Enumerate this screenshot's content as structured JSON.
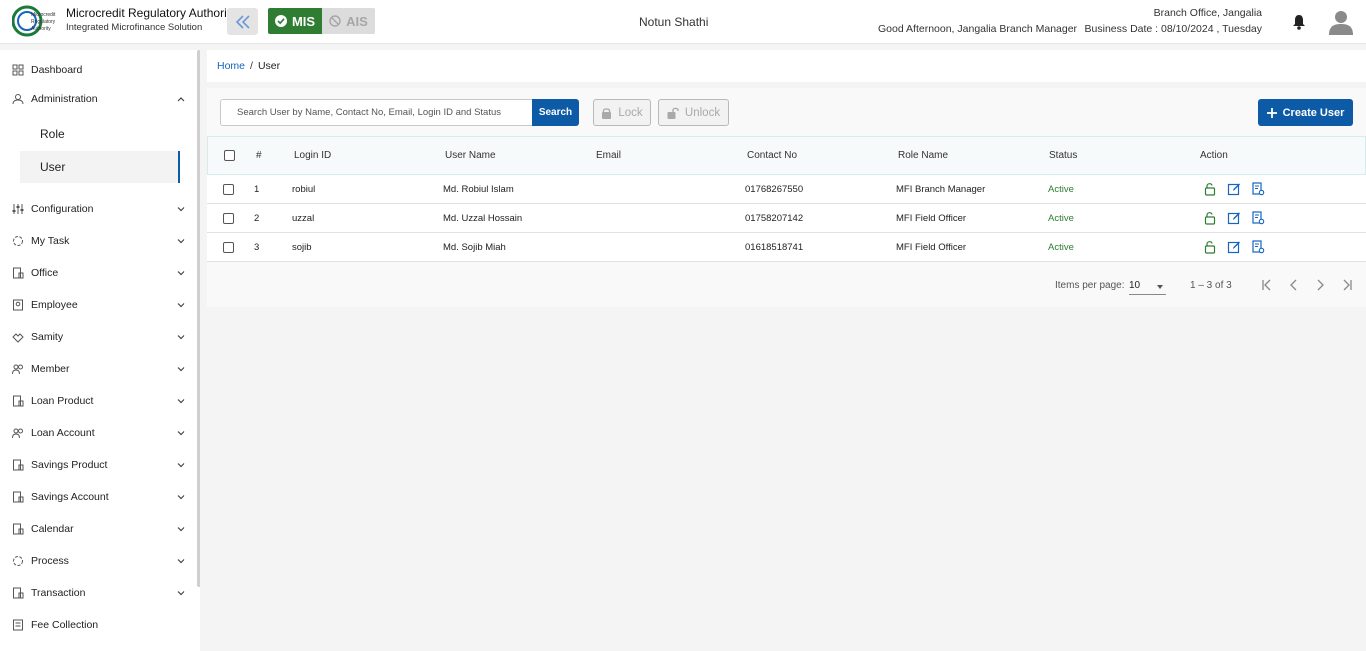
{
  "header": {
    "org_name": "Microcredit Regulatory Authority",
    "org_sub": "Integrated Microfinance Solution",
    "logo_text": [
      "Microcredit",
      "Regulatory",
      "Authority"
    ],
    "mis_label": "MIS",
    "ais_label": "AIS",
    "app_title": "Notun Shathi",
    "greeting": "Good Afternoon, Jangalia Branch Manager",
    "branch": "Branch Office, Jangalia",
    "business_date": "Business Date : 08/10/2024 , Tuesday"
  },
  "sidebar": {
    "items": [
      {
        "label": "Dashboard",
        "icon": "grid-icon"
      },
      {
        "label": "Administration",
        "icon": "admin-icon",
        "expanded": true
      },
      {
        "label": "Role"
      },
      {
        "label": "User",
        "active": true
      },
      {
        "label": "Configuration",
        "icon": "sliders-icon"
      },
      {
        "label": "My Task",
        "icon": "task-icon"
      },
      {
        "label": "Office",
        "icon": "office-icon"
      },
      {
        "label": "Employee",
        "icon": "employee-icon"
      },
      {
        "label": "Samity",
        "icon": "samity-icon"
      },
      {
        "label": "Member",
        "icon": "member-icon"
      },
      {
        "label": "Loan Product",
        "icon": "loan-product-icon"
      },
      {
        "label": "Loan Account",
        "icon": "loan-account-icon"
      },
      {
        "label": "Savings Product",
        "icon": "savings-product-icon"
      },
      {
        "label": "Savings Account",
        "icon": "savings-account-icon"
      },
      {
        "label": "Calendar",
        "icon": "calendar-icon"
      },
      {
        "label": "Process",
        "icon": "process-icon"
      },
      {
        "label": "Transaction",
        "icon": "transaction-icon"
      },
      {
        "label": "Fee Collection",
        "icon": "fee-icon"
      }
    ]
  },
  "breadcrumb": {
    "home": "Home",
    "sep": "/",
    "current": "User"
  },
  "toolbar": {
    "search_placeholder": "Search User by Name, Contact No, Email, Login ID and Status",
    "search_label": "Search",
    "lock_label": "Lock",
    "unlock_label": "Unlock",
    "create_label": "Create User"
  },
  "table": {
    "columns": [
      "#",
      "Login ID",
      "User Name",
      "Email",
      "Contact No",
      "Role Name",
      "Status",
      "Action"
    ],
    "rows": [
      {
        "num": "1",
        "login": "robiul",
        "name": "Md. Robiul Islam",
        "email": "",
        "contact": "01768267550",
        "role": "MFI Branch Manager",
        "status": "Active"
      },
      {
        "num": "2",
        "login": "uzzal",
        "name": "Md. Uzzal Hossain",
        "email": "",
        "contact": "01758207142",
        "role": "MFI Field Officer",
        "status": "Active"
      },
      {
        "num": "3",
        "login": "sojib",
        "name": "Md. Sojib Miah",
        "email": "",
        "contact": "01618518741",
        "role": "MFI Field Officer",
        "status": "Active"
      }
    ]
  },
  "pager": {
    "items_label": "Items per page:",
    "items_value": "10",
    "range": "1 – 3 of 3"
  },
  "colors": {
    "primary": "#0d5aa7",
    "mis_green": "#2f7d32",
    "active_green": "#2e7d32"
  }
}
